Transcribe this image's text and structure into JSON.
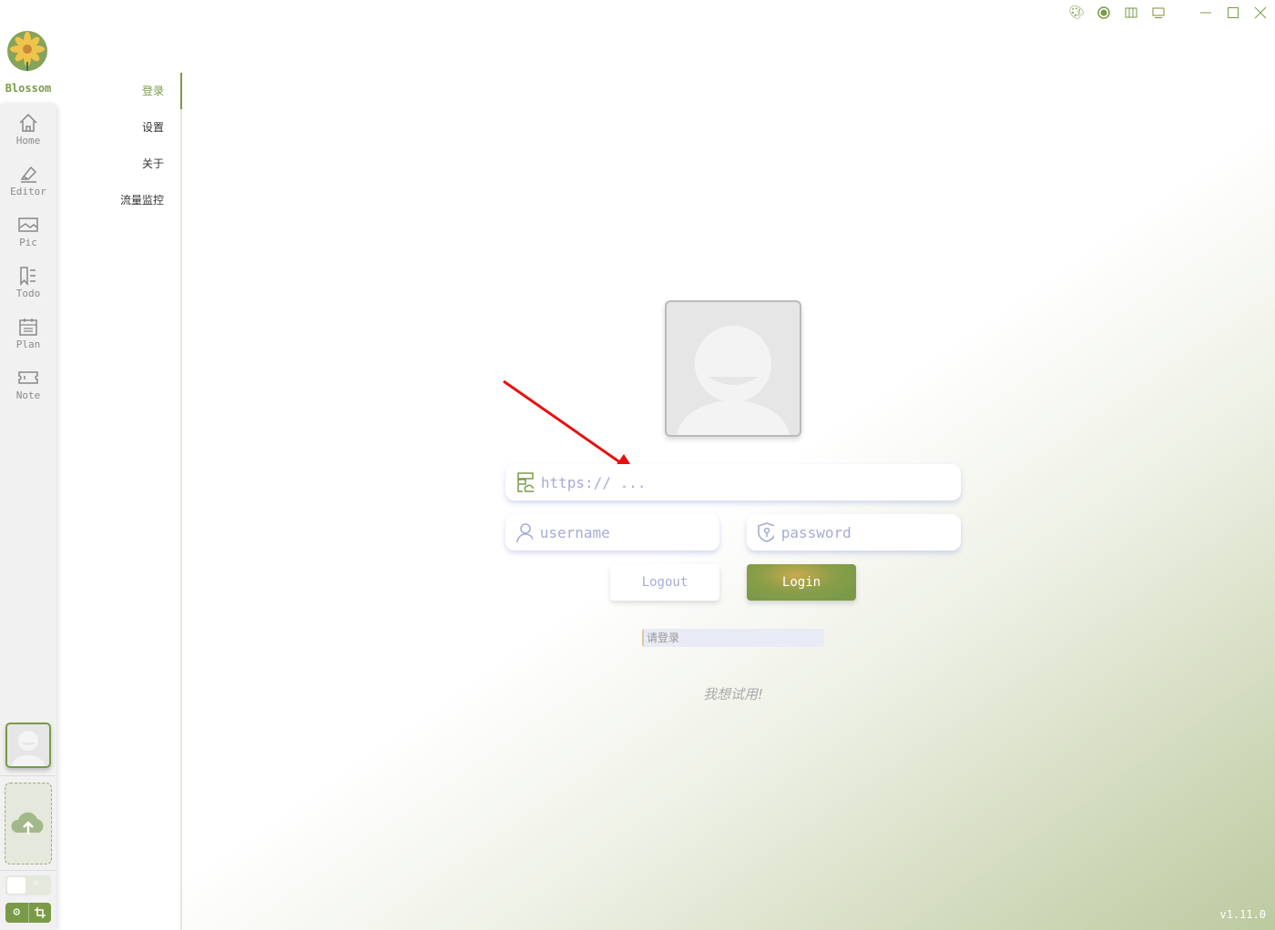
{
  "app": {
    "name": "Blossom",
    "version": "v1.11.0"
  },
  "window_controls": [
    "palette-icon",
    "record-icon",
    "columns-icon",
    "monitor-icon",
    "minimize-icon",
    "maximize-icon",
    "close-icon"
  ],
  "rail": {
    "items": [
      {
        "label": "Home",
        "icon": "home-icon"
      },
      {
        "label": "Editor",
        "icon": "highlighter-icon"
      },
      {
        "label": "Pic",
        "icon": "image-icon"
      },
      {
        "label": "Todo",
        "icon": "bookmark-list-icon"
      },
      {
        "label": "Plan",
        "icon": "calendar-icon"
      },
      {
        "label": "Note",
        "icon": "ticket-icon"
      }
    ]
  },
  "subnav": {
    "items": [
      {
        "label": "登录",
        "active": true
      },
      {
        "label": "设置"
      },
      {
        "label": "关于"
      },
      {
        "label": "流量监控"
      }
    ]
  },
  "login": {
    "url_placeholder": "https:// ...",
    "username_placeholder": "username",
    "password_placeholder": "password",
    "logout_label": "Logout",
    "login_label": "Login",
    "status": "请登录",
    "trial_link": "我想试用!"
  },
  "colors": {
    "accent": "#7a9a48",
    "field_text": "#a4abd8"
  }
}
